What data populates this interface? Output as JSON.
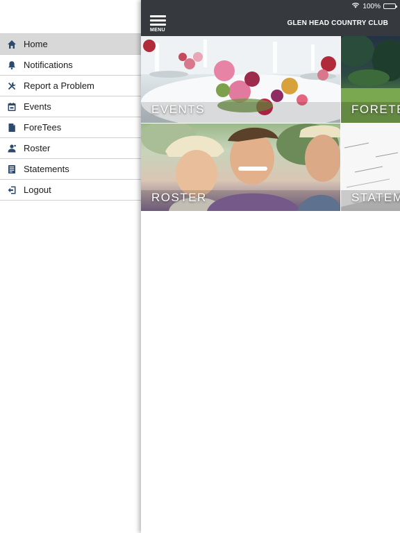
{
  "status_bar": {
    "battery_text": "100%"
  },
  "header": {
    "menu_label": "MENU",
    "club_name": "GLEN HEAD COUNTRY CLUB"
  },
  "side_menu": {
    "items": [
      {
        "label": "Home",
        "icon": "home-icon",
        "active": true
      },
      {
        "label": "Notifications",
        "icon": "bell-icon"
      },
      {
        "label": "Report a Problem",
        "icon": "tools-icon"
      },
      {
        "label": "Events",
        "icon": "calendar-icon"
      },
      {
        "label": "ForeTees",
        "icon": "document-icon"
      },
      {
        "label": "Roster",
        "icon": "person-icon"
      },
      {
        "label": "Statements",
        "icon": "statement-icon"
      },
      {
        "label": "Logout",
        "icon": "logout-icon"
      }
    ]
  },
  "tiles": [
    {
      "label": "EVENTS"
    },
    {
      "label": "FORETE"
    },
    {
      "label": "ROSTER"
    },
    {
      "label": "STATEM"
    }
  ],
  "colors": {
    "header_bg": "#36393d",
    "menu_active_bg": "#d8d8d8",
    "icon_color": "#2b4a6e"
  }
}
